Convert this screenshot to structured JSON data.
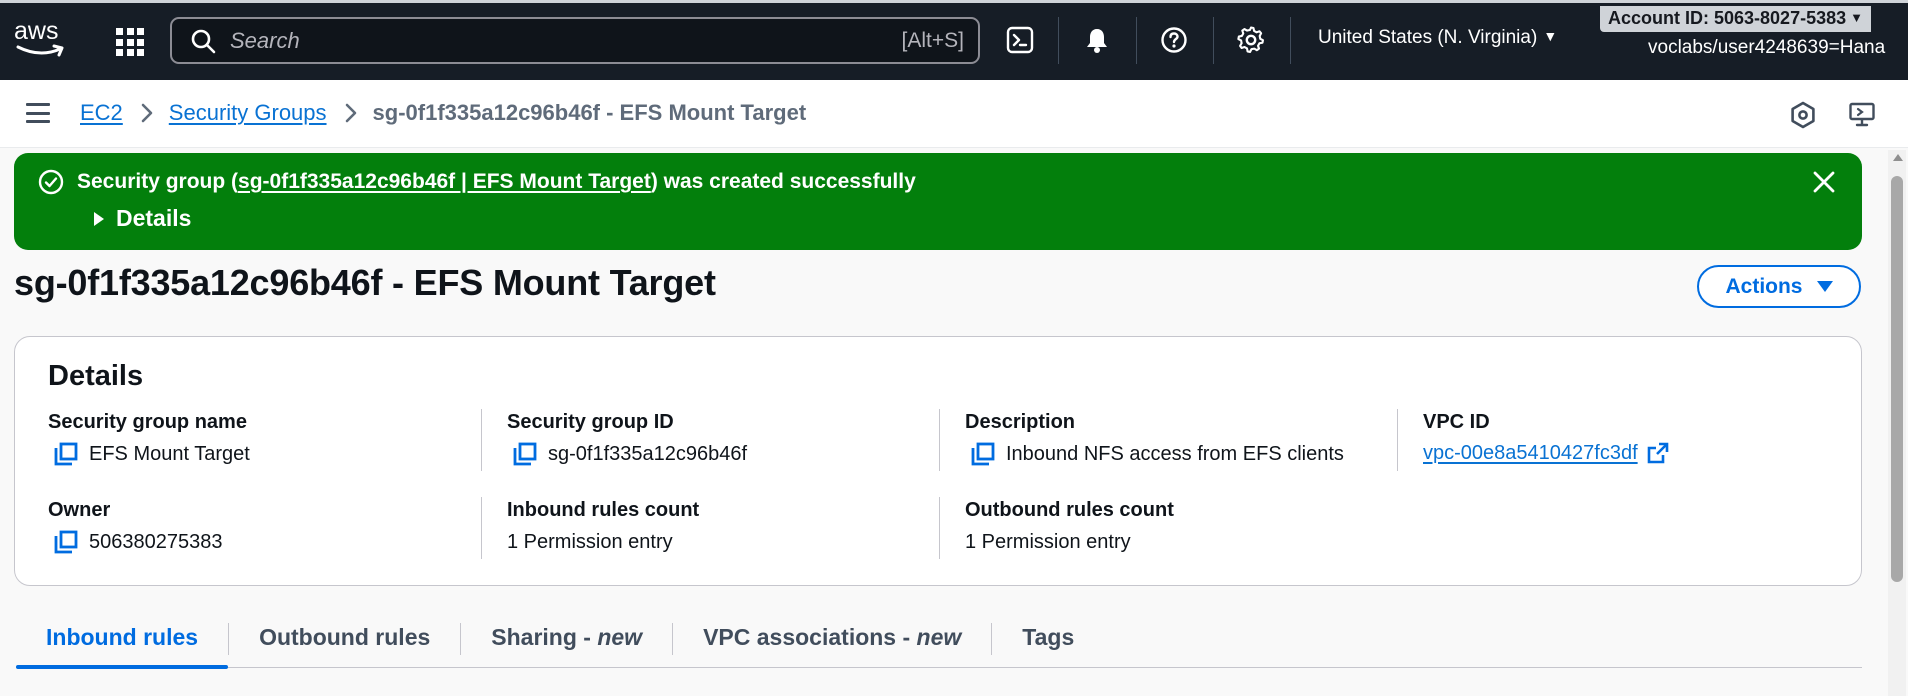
{
  "topnav": {
    "logo_text": "aws",
    "search_placeholder": "Search",
    "search_shortcut": "[Alt+S]",
    "region": "United States (N. Virginia)",
    "account": "Account ID: 5063-8027-5383",
    "user": "voclabs/user4248639=Hana"
  },
  "breadcrumb": {
    "items": [
      "EC2",
      "Security Groups"
    ],
    "current": "sg-0f1f335a12c96b46f - EFS Mount Target"
  },
  "flash": {
    "prefix": "Security group (",
    "link": "sg-0f1f335a12c96b46f | EFS Mount Target",
    "suffix": ") was created successfully",
    "details_label": "Details",
    "color": "#037f0c"
  },
  "page": {
    "title": "sg-0f1f335a12c96b46f - EFS Mount Target",
    "actions_label": "Actions"
  },
  "details": {
    "heading": "Details",
    "fields": {
      "sg_name": {
        "label": "Security group name",
        "value": "EFS Mount Target"
      },
      "sg_id": {
        "label": "Security group ID",
        "value": "sg-0f1f335a12c96b46f"
      },
      "description": {
        "label": "Description",
        "value": "Inbound NFS access from EFS clients"
      },
      "vpc_id": {
        "label": "VPC ID",
        "value": "vpc-00e8a5410427fc3df"
      },
      "owner": {
        "label": "Owner",
        "value": "506380275383"
      },
      "inbound_count": {
        "label": "Inbound rules count",
        "value": "1 Permission entry"
      },
      "outbound_count": {
        "label": "Outbound rules count",
        "value": "1 Permission entry"
      }
    }
  },
  "tabs": {
    "inbound": "Inbound rules",
    "outbound": "Outbound rules",
    "sharing": "Sharing - ",
    "sharing_new": "new",
    "vpc_assoc": "VPC associations - ",
    "vpc_assoc_new": "new",
    "tags": "Tags"
  },
  "colors": {
    "accent": "#006ce0",
    "nav_bg": "#161d26",
    "success": "#037f0c"
  }
}
